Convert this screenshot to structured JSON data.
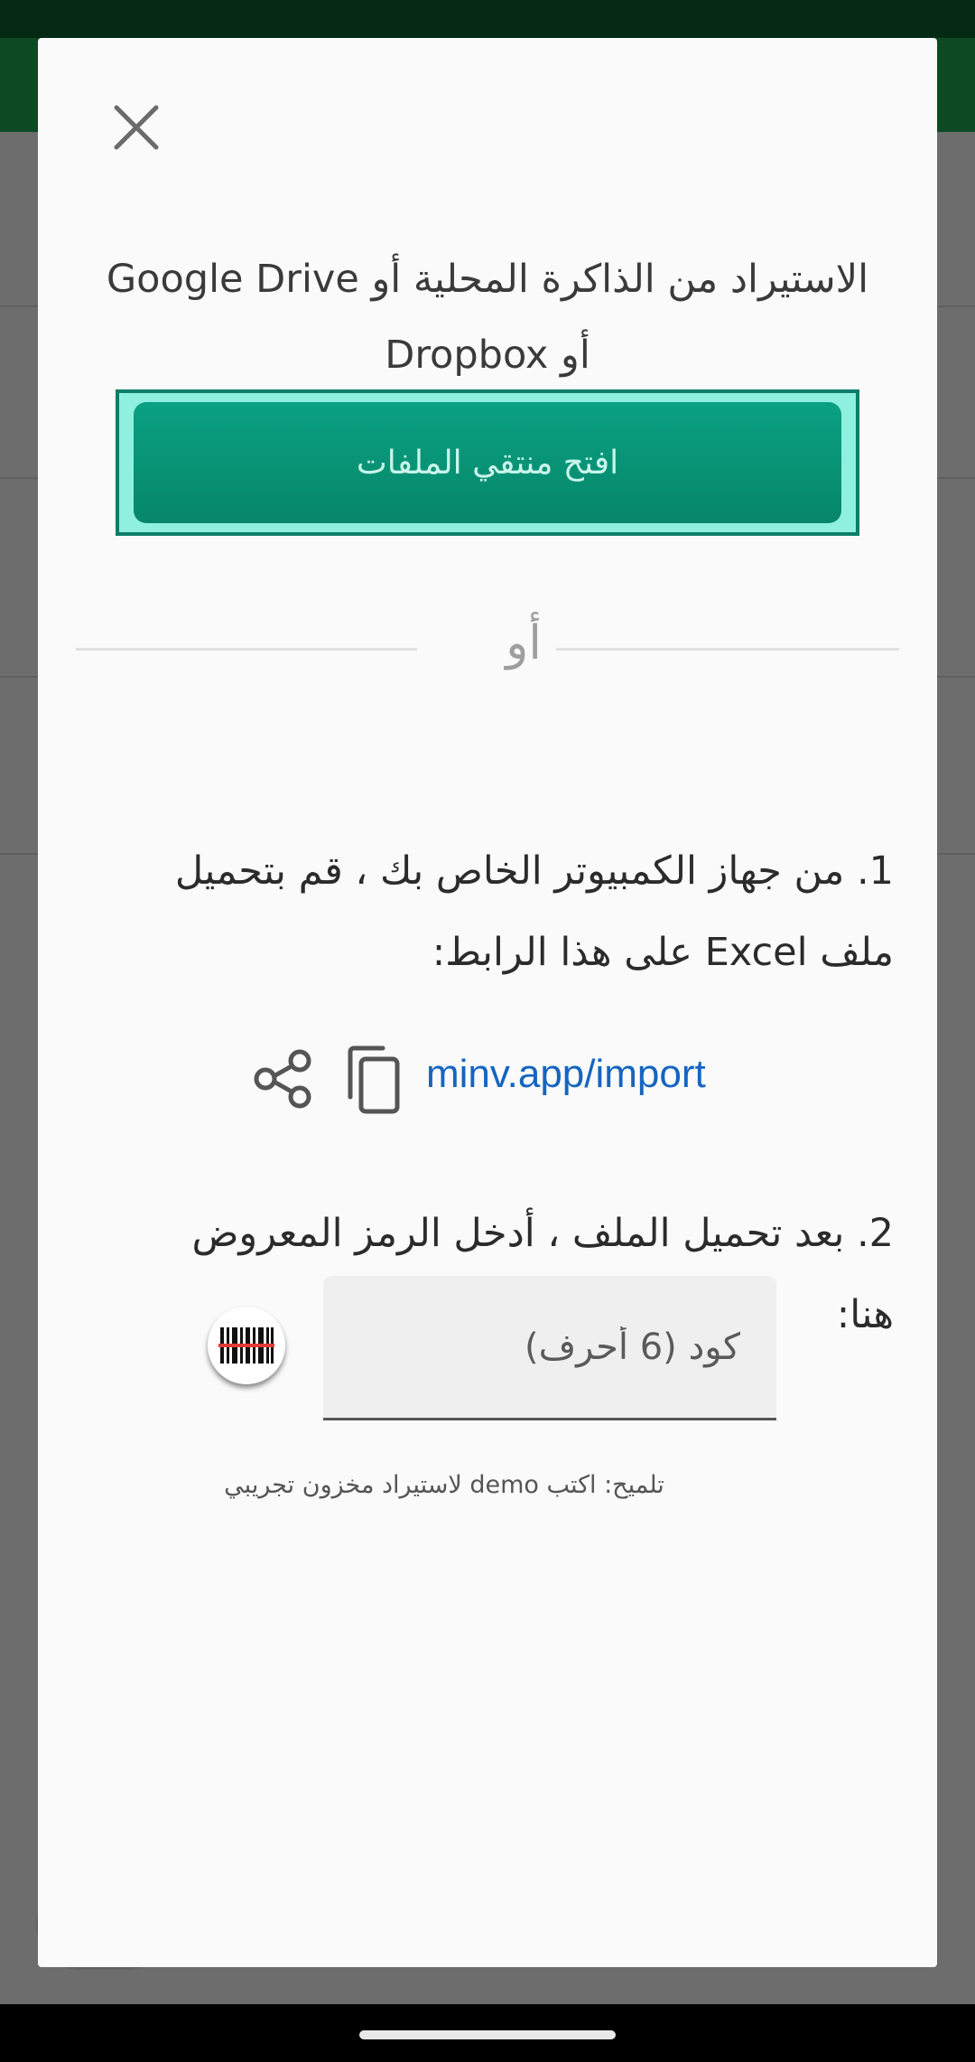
{
  "dialog": {
    "heading": "الاستيراد من الذاكرة المحلية أو Google Drive أو Dropbox",
    "picker_button_label": "افتح منتقي الملفات",
    "or_label": "أو",
    "step1_text": "1. من جهاز الكمبيوتر الخاص بك ، قم بتحميل ملف Excel على هذا الرابط:",
    "link": "minv.app/import",
    "step2_text": "2. بعد تحميل الملف ، أدخل الرمز المعروض هنا:",
    "code_placeholder": "كود (6 أحرف)",
    "code_value": "",
    "hint": "تلميح: اكتب demo لاستيراد مخزون تجريبي"
  },
  "icons": {
    "close": "close-icon",
    "share": "share-icon",
    "copy": "copy-icon",
    "barcode": "barcode-scan-icon"
  },
  "colors": {
    "primary": "#07866a",
    "link": "#1565c0",
    "appbar": "#0d4a23"
  }
}
